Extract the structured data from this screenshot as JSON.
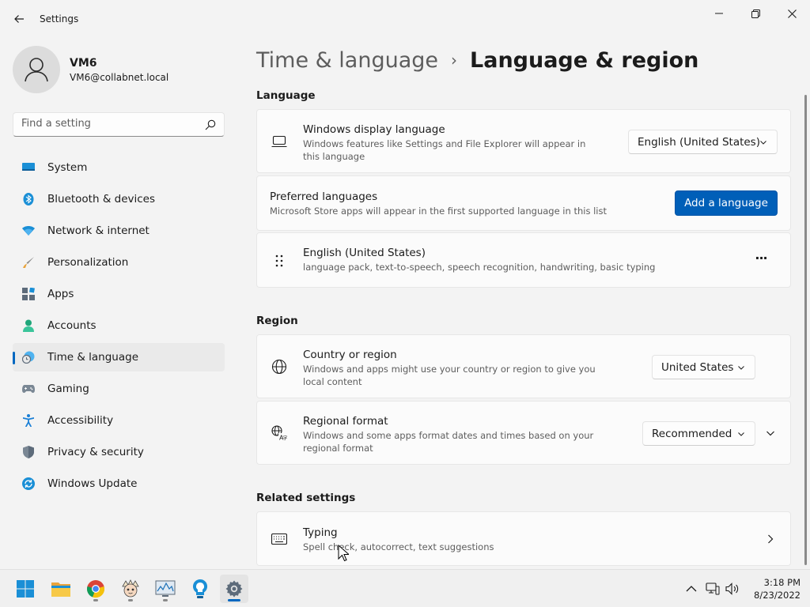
{
  "window": {
    "title": "Settings",
    "controls": [
      "minimize-icon",
      "maximize-icon",
      "close-icon"
    ]
  },
  "profile": {
    "name": "VM6",
    "email": "VM6@collabnet.local"
  },
  "search": {
    "placeholder": "Find a setting"
  },
  "sidebar": {
    "items": [
      {
        "label": "System",
        "icon": "system-icon"
      },
      {
        "label": "Bluetooth & devices",
        "icon": "bluetooth-icon"
      },
      {
        "label": "Network & internet",
        "icon": "network-icon"
      },
      {
        "label": "Personalization",
        "icon": "brush-icon"
      },
      {
        "label": "Apps",
        "icon": "apps-icon"
      },
      {
        "label": "Accounts",
        "icon": "accounts-icon"
      },
      {
        "label": "Time & language",
        "icon": "time-language-icon",
        "active": true
      },
      {
        "label": "Gaming",
        "icon": "gaming-icon"
      },
      {
        "label": "Accessibility",
        "icon": "accessibility-icon"
      },
      {
        "label": "Privacy & security",
        "icon": "shield-icon"
      },
      {
        "label": "Windows Update",
        "icon": "update-icon"
      }
    ]
  },
  "breadcrumb": {
    "parent": "Time & language",
    "separator": "›",
    "current": "Language & region"
  },
  "language": {
    "section_title": "Language",
    "display_language": {
      "title": "Windows display language",
      "description": "Windows features like Settings and File Explorer will appear in this language",
      "value": "English (United States)"
    },
    "preferred": {
      "title": "Preferred languages",
      "description": "Microsoft Store apps will appear in the first supported language in this list",
      "button": "Add a language"
    },
    "installed": {
      "title": "English (United States)",
      "description": "language pack, text-to-speech, speech recognition, handwriting, basic typing",
      "more": "···"
    }
  },
  "region": {
    "section_title": "Region",
    "country": {
      "title": "Country or region",
      "description": "Windows and apps might use your country or region to give you local content",
      "value": "United States"
    },
    "format": {
      "title": "Regional format",
      "description": "Windows and some apps format dates and times based on your regional format",
      "value": "Recommended"
    }
  },
  "related": {
    "section_title": "Related settings",
    "typing": {
      "title": "Typing",
      "description": "Spell check, autocorrect, text suggestions"
    }
  },
  "taskbar": {
    "apps": [
      "start-icon",
      "file-explorer-icon",
      "chrome-icon",
      "character-app-icon",
      "monitor-app-icon",
      "lightbulb-app-icon",
      "settings-app-icon"
    ],
    "time": "3:18 PM",
    "date": "8/23/2022"
  },
  "colors": {
    "accent": "#005fb8",
    "background": "#f3f3f3",
    "card": "#fbfbfb"
  }
}
